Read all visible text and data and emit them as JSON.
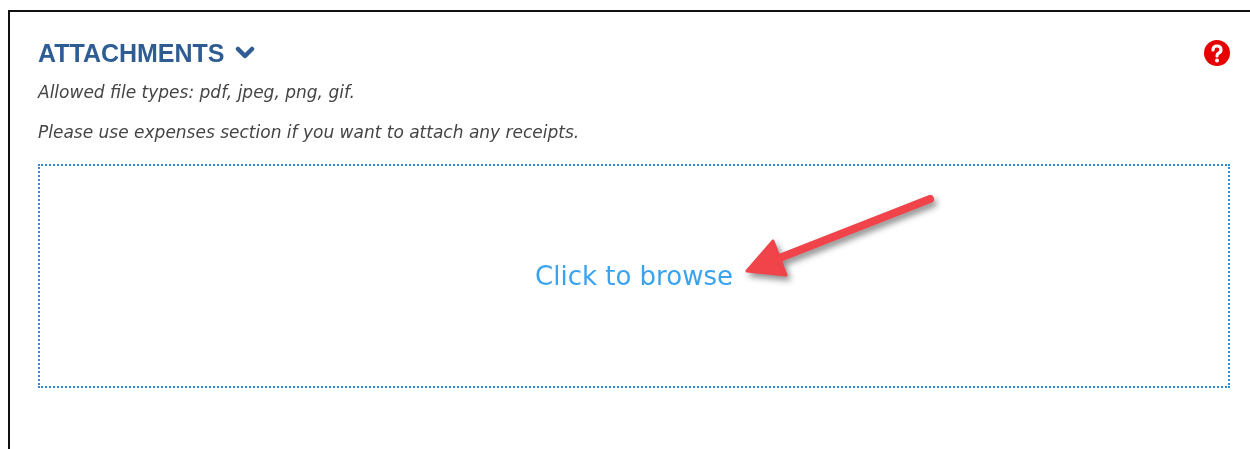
{
  "section": {
    "title": "ATTACHMENTS",
    "expanded": true,
    "notes": [
      "Allowed file types: pdf, jpeg, png, gif.",
      "Please use expenses section if you want to attach any receipts."
    ],
    "dropzone": {
      "link": "Click to browse"
    }
  }
}
